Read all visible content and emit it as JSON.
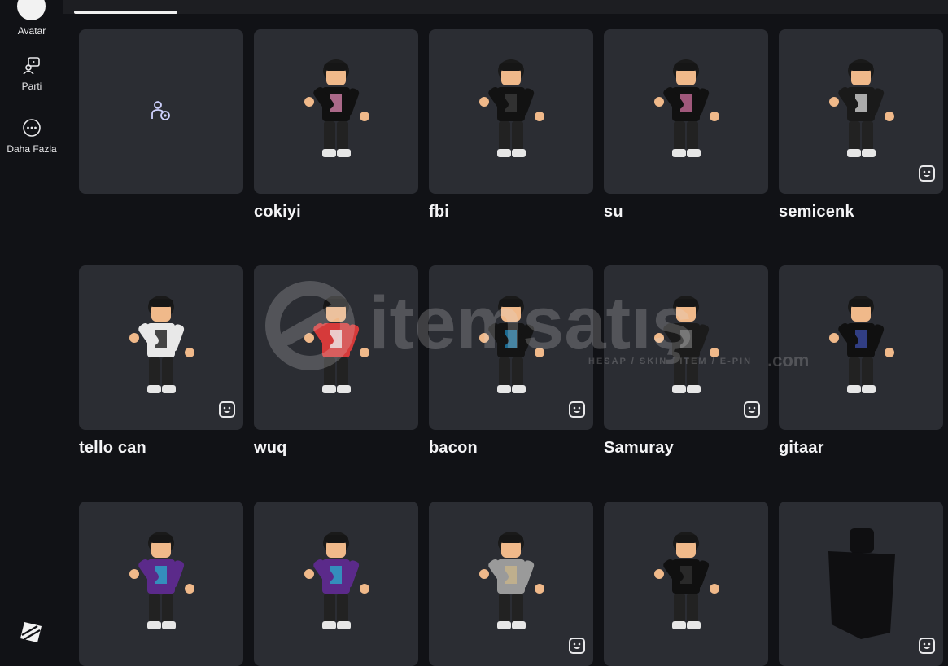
{
  "sidebar": {
    "items": [
      {
        "label": "Avatar",
        "icon": "avatar-icon"
      },
      {
        "label": "Parti",
        "icon": "party-icon"
      },
      {
        "label": "Daha Fazla",
        "icon": "more-icon"
      }
    ],
    "logo": "roblox-logo-icon"
  },
  "outfits": [
    {
      "name": "",
      "type": "create",
      "badge": false
    },
    {
      "name": "cokiyi",
      "badge": false,
      "shirt": "#111",
      "accent": "#d27fa8"
    },
    {
      "name": "fbi",
      "badge": false,
      "shirt": "#121212",
      "accent": "#3a3a3a"
    },
    {
      "name": "su",
      "badge": false,
      "shirt": "#111",
      "accent": "#c46a96"
    },
    {
      "name": "semicenk",
      "badge": true,
      "shirt": "#1a1a1a",
      "accent": "#cfcfcf"
    },
    {
      "name": "tello can",
      "badge": true,
      "shirt": "#e8e8e8",
      "accent": "#1a1a1a"
    },
    {
      "name": "wuq",
      "badge": false,
      "shirt": "#d63a3a",
      "accent": "#f0f0f0"
    },
    {
      "name": "bacon",
      "badge": true,
      "shirt": "#141414",
      "accent": "#1e7fb0"
    },
    {
      "name": "Samuray",
      "badge": true,
      "shirt": "#1b1b1b",
      "accent": "#6a6a6a"
    },
    {
      "name": "gitaar",
      "badge": false,
      "shirt": "#101010",
      "accent": "#3a4aa0"
    },
    {
      "name": "",
      "badge": false,
      "shirt": "#5b2a8a",
      "accent": "#2aa8c8"
    },
    {
      "name": "",
      "badge": false,
      "shirt": "#5b2a8a",
      "accent": "#2aa8c8"
    },
    {
      "name": "",
      "badge": true,
      "shirt": "#9a9a9a",
      "accent": "#c8b48a"
    },
    {
      "name": "",
      "badge": false,
      "shirt": "#101010",
      "accent": "#303030"
    },
    {
      "name": "",
      "type": "silhouette",
      "badge": true
    }
  ],
  "watermark": {
    "brand": "itemsatış",
    "tagline": "HESAP / SKIN / ITEM / E-PIN",
    "tld": ".com"
  },
  "colors": {
    "background": "#111216",
    "tile": "#2b2d33",
    "text": "#f4f4f6"
  }
}
